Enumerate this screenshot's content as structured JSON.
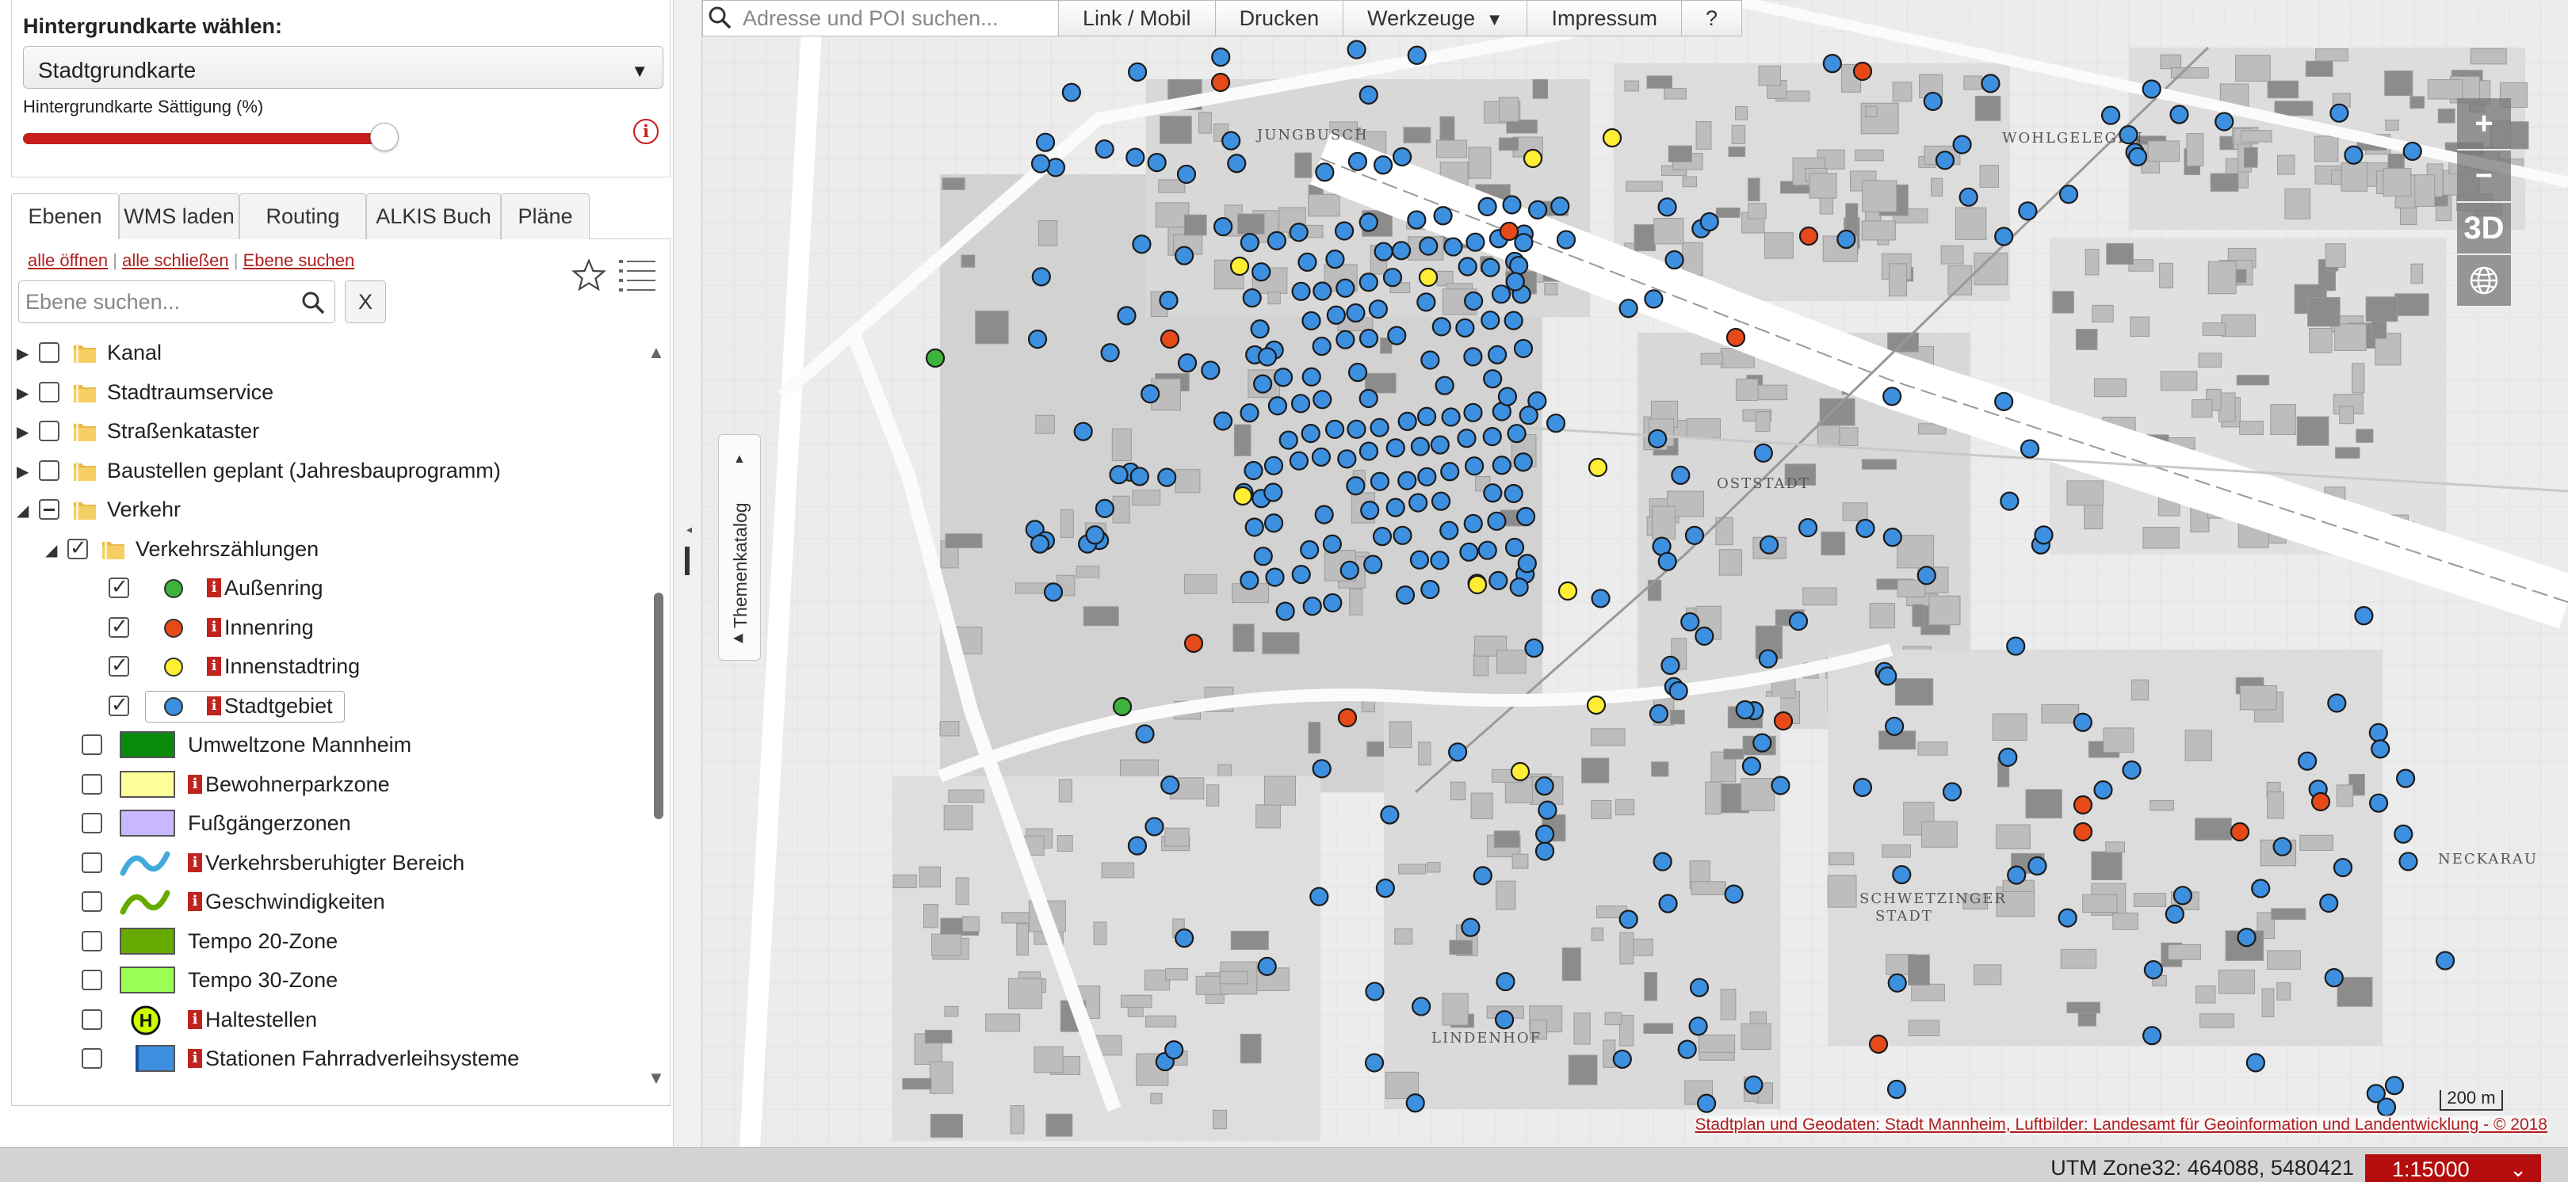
{
  "background_map": {
    "title": "Hintergrundkarte wählen:",
    "selected": "Stadtgrundkarte",
    "saturation_label": "Hintergrundkarte Sättigung (%)",
    "saturation_percent": 100,
    "colors": {
      "slider": "#c61c1c"
    }
  },
  "tabs": [
    {
      "label": "Ebenen",
      "active": true
    },
    {
      "label": "WMS laden",
      "active": false
    },
    {
      "label": "Routing",
      "active": false
    },
    {
      "label": "ALKIS Buch",
      "active": false
    },
    {
      "label": "Pläne",
      "active": false
    }
  ],
  "layer_tree": {
    "link_open_all": "alle öffnen",
    "link_close_all": "alle schließen",
    "link_search_layer": "Ebene suchen",
    "separator": "|",
    "search_placeholder": "Ebene suchen...",
    "clear_label": "X",
    "items": [
      {
        "label": "Kanal",
        "type": "folder",
        "expanded": false,
        "checked": false,
        "level": 0
      },
      {
        "label": "Stadtraumservice",
        "type": "folder",
        "expanded": false,
        "checked": false,
        "level": 0
      },
      {
        "label": "Straßenkataster",
        "type": "folder",
        "expanded": false,
        "checked": false,
        "level": 0
      },
      {
        "label": "Baustellen geplant (Jahresbauprogramm)",
        "type": "folder",
        "expanded": false,
        "checked": false,
        "level": 0
      },
      {
        "label": "Verkehr",
        "type": "folder",
        "expanded": true,
        "checked": "partial",
        "level": 0
      },
      {
        "label": "Verkehrszählungen",
        "type": "folder",
        "expanded": true,
        "checked": true,
        "level": 1
      },
      {
        "label": "Außenring",
        "type": "dot",
        "color": "#3cb43c",
        "checked": true,
        "info": true,
        "level": 2
      },
      {
        "label": "Innenring",
        "type": "dot",
        "color": "#e64a19",
        "checked": true,
        "info": true,
        "level": 2
      },
      {
        "label": "Innenstadtring",
        "type": "dot",
        "color": "#ffee33",
        "checked": true,
        "info": true,
        "level": 2
      },
      {
        "label": "Stadtgebiet",
        "type": "dot",
        "color": "#3d8fe0",
        "checked": true,
        "info": true,
        "level": 2
      },
      {
        "label": "Umweltzone Mannheim",
        "type": "rect",
        "color": "#0a8a0a",
        "checked": false,
        "info": false,
        "level": 1
      },
      {
        "label": "Bewohnerparkzone",
        "type": "rect",
        "color": "#ffff99",
        "checked": false,
        "info": true,
        "level": 1
      },
      {
        "label": "Fußgängerzonen",
        "type": "rect",
        "color": "#c9b8ff",
        "checked": false,
        "info": false,
        "level": 1
      },
      {
        "label": "Verkehrsberuhigter Bereich",
        "type": "wave",
        "color": "#44aadd",
        "checked": false,
        "info": true,
        "level": 1
      },
      {
        "label": "Geschwindigkeiten",
        "type": "wave",
        "color": "#66aa00",
        "checked": false,
        "info": true,
        "level": 1
      },
      {
        "label": "Tempo 20-Zone",
        "type": "rect",
        "color": "#66aa00",
        "checked": false,
        "info": false,
        "level": 1
      },
      {
        "label": "Tempo 30-Zone",
        "type": "rect",
        "color": "#99ff55",
        "checked": false,
        "info": false,
        "level": 1
      },
      {
        "label": "Haltestellen",
        "type": "stop",
        "color": "#ccff00",
        "checked": false,
        "info": true,
        "level": 1
      },
      {
        "label": "Stationen Fahrradverleihsysteme",
        "type": "bike",
        "color": "#3d8fe0",
        "checked": false,
        "info": true,
        "level": 1
      }
    ]
  },
  "map": {
    "search_placeholder": "Adresse und POI suchen...",
    "toolbar": {
      "link_mobil": "Link / Mobil",
      "print": "Drucken",
      "tools": "Werkzeuge",
      "tools_arrow": "▼",
      "imprint": "Impressum",
      "help": "?"
    },
    "theme_catalog": "Themenkatalog",
    "zoom_in": "+",
    "zoom_out": "−",
    "view_3d": "3D",
    "scale_text": "200 m",
    "attribution": "Stadtplan und Geodaten: Stadt Mannheim, Luftbilder: Landesamt für Geoinformation und Landentwicklung - © 2018",
    "district_labels": [
      "JUNGBUSCH",
      "WOHLGELEGEN",
      "OSTSTADT",
      "SCHWETZINGER STADT",
      "LINDENHOF",
      "NECKARAU"
    ],
    "marker_colors": {
      "aussenring": "#3cb43c",
      "innenring": "#e64a19",
      "innenstadtring": "#ffee33",
      "stadtgebiet": "#3d8fe0"
    },
    "marker_counts": {
      "aussenring": 2,
      "innenring": 15,
      "innenstadtring": 10
    }
  },
  "status": {
    "coords": "UTM Zone32: 464088, 5480421",
    "scale": "1:15000",
    "scale_arrow": "⌄"
  }
}
